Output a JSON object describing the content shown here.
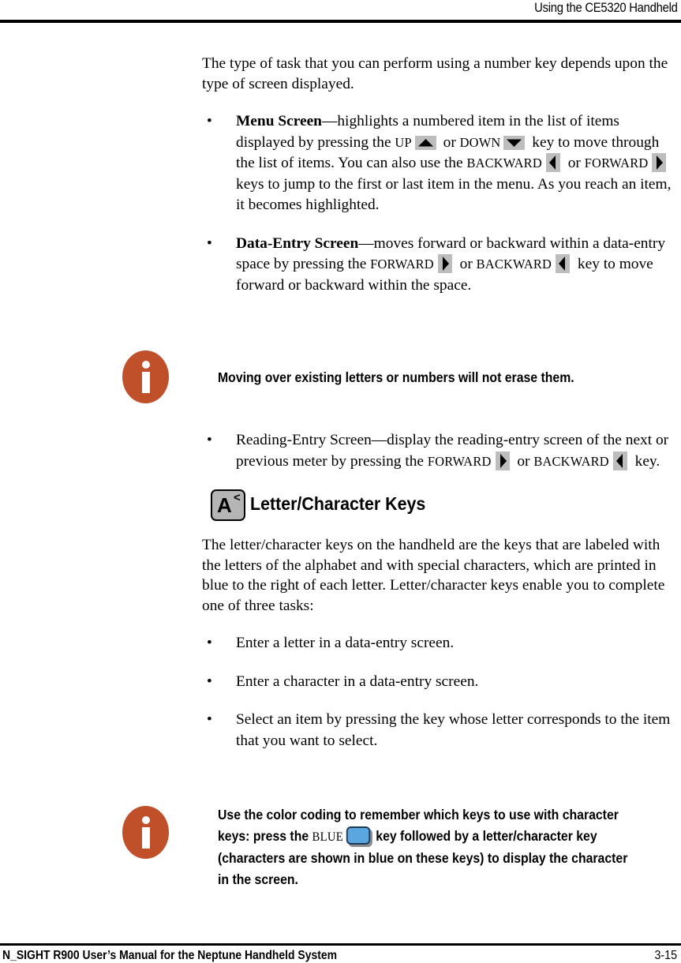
{
  "header": {
    "title": "Using the CE5320 Handheld"
  },
  "footer": {
    "manual_title": "N_SIGHT R900 User’s Manual for the Neptune Handheld System",
    "page_number": "3-15"
  },
  "colors": {
    "note_icon": "#c0502a",
    "key_gray": "#bdbdbd",
    "keycap_gray": "#b5b5b5",
    "blue_key": "#5ba6dc",
    "blue_key_border": "#1b3a5c",
    "rule": "#000000"
  },
  "content": {
    "intro_paragraph": "The type of task that you can perform using a number key depends upon the type of screen displayed.",
    "bullets": [
      {
        "name": "menu-screen",
        "bold_lead": "Menu Screen",
        "text_1": "—highlights a numbered item in the list of items displayed by pressing the ",
        "key_1": "UP",
        "text_2": " or ",
        "key_2": "DOWN",
        "text_3": " key to move through the list of items. You can also use the ",
        "key_3": "BACKWARD",
        "text_4": " or ",
        "key_4": "FORWARD",
        "text_5": " keys to jump to the first or last item in the menu. As you reach an item, it becomes highlighted."
      },
      {
        "name": "data-entry-screen",
        "bold_lead": "Data-Entry Screen",
        "text_1": "—moves forward or backward within a data-entry space by pressing the ",
        "key_1": "FORWARD",
        "text_2": " or ",
        "key_2": "BACKWARD",
        "text_3": " key to move forward or backward within the space."
      }
    ],
    "reading_entry_bullet": {
      "name": "reading-entry-screen",
      "lead": "Reading-Entry Screen",
      "text_1": "—display the reading-entry screen of the next or previous meter by pressing the ",
      "key_1": "FORWARD",
      "text_2": " or ",
      "key_2": "BACKWARD",
      "text_3": " key."
    },
    "section": {
      "keycap_letter": "A",
      "keycap_superscript": "<",
      "heading": "Letter/Character Keys",
      "paragraph": "The letter/character keys on the handheld are the keys that are labeled with the letters of the alphabet and with special characters, which are printed in blue to the right of each letter. Letter/character keys enable you to complete one of three tasks:",
      "task_bullets": [
        "Enter a letter in a data-entry screen.",
        "Enter a character in a data-entry screen.",
        "Select an item by pressing the key whose letter corresponds to the item that you want to select."
      ]
    },
    "notes": [
      {
        "name": "note-moving-over-letters",
        "icon": "info-icon",
        "text": "Moving over existing letters or numbers will not erase them."
      },
      {
        "name": "note-color-coding",
        "icon": "info-icon",
        "text_1": "Use the color coding to remember which keys to use with character keys: press the ",
        "key_label": "BLUE",
        "text_2": " key followed by a letter/character key (characters are shown in blue on these keys) to display the character in the screen."
      }
    ]
  }
}
